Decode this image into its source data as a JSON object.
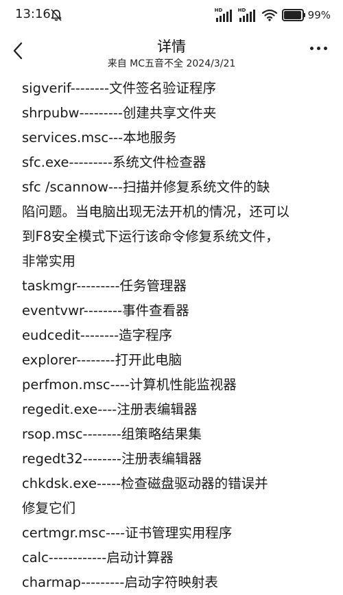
{
  "status_bar": {
    "time": "13:16",
    "signal_1_label": "HD",
    "signal_2_label": "HD",
    "battery_percent": "99%",
    "battery_level": 0.99
  },
  "header": {
    "title": "详情",
    "subtitle": "来自 MC五音不全 2024/3/21"
  },
  "content": {
    "lines": [
      "sigverif--------文件签名验证程序",
      "shrpubw---------创建共享文件夹",
      "services.msc---本地服务",
      "sfc.exe---------系统文件检查器",
      "sfc /scannow---扫描并修复系统文件的缺",
      "陷问题。当电脑出现无法开机的情况，还可以",
      "到F8安全模式下运行该命令修复系统文件，",
      "非常实用",
      "taskmgr---------任务管理器",
      "eventvwr--------事件查看器",
      "eudcedit--------造字程序",
      "explorer--------打开此电脑",
      "perfmon.msc----计算机性能监视器",
      "regedit.exe----注册表编辑器",
      "rsop.msc--------组策略结果集",
      "regedt32--------注册表编辑器",
      "chkdsk.exe-----检查磁盘驱动器的错误并",
      "修复它们",
      "certmgr.msc----证书管理实用程序",
      "calc------------启动计算器",
      "charmap---------启动字符映射表"
    ]
  }
}
